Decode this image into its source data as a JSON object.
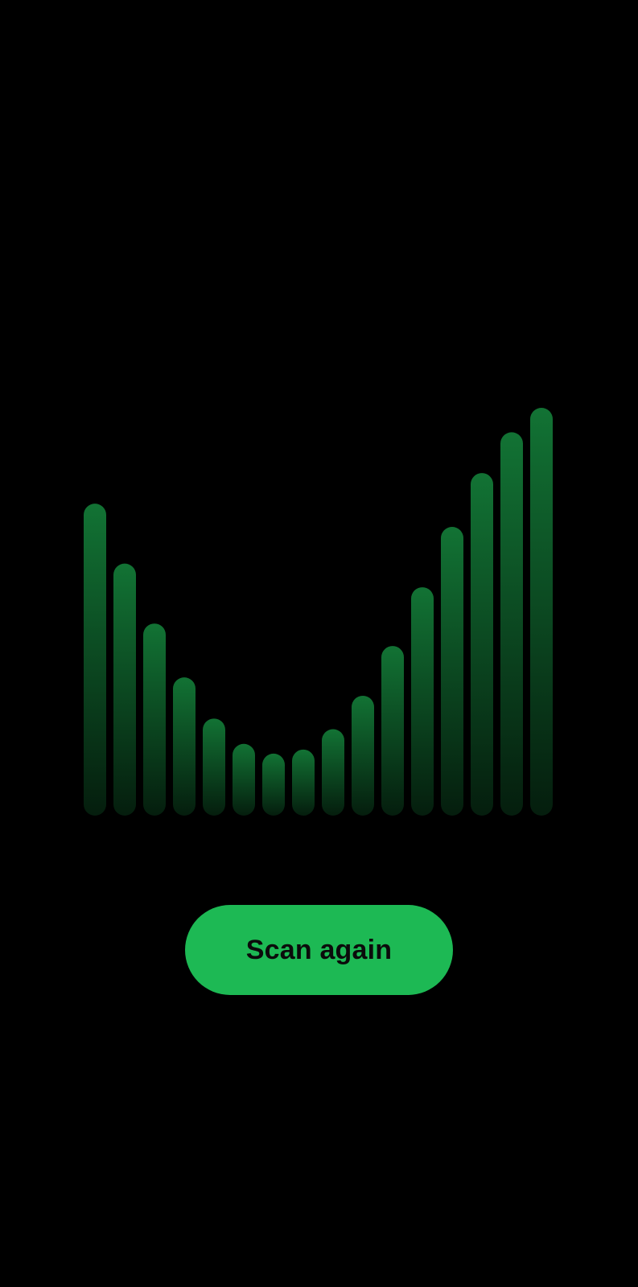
{
  "app": {
    "background_color": "#000000"
  },
  "visualizer": {
    "bar_color": "#1db954",
    "bar_levels": [
      0.765,
      0.618,
      0.471,
      0.339,
      0.238,
      0.176,
      0.152,
      0.162,
      0.212,
      0.294,
      0.416,
      0.56,
      0.708,
      0.84,
      0.94,
      1.0
    ]
  },
  "actions": {
    "scan_again_label": "Scan again",
    "button_color": "#1db954"
  }
}
